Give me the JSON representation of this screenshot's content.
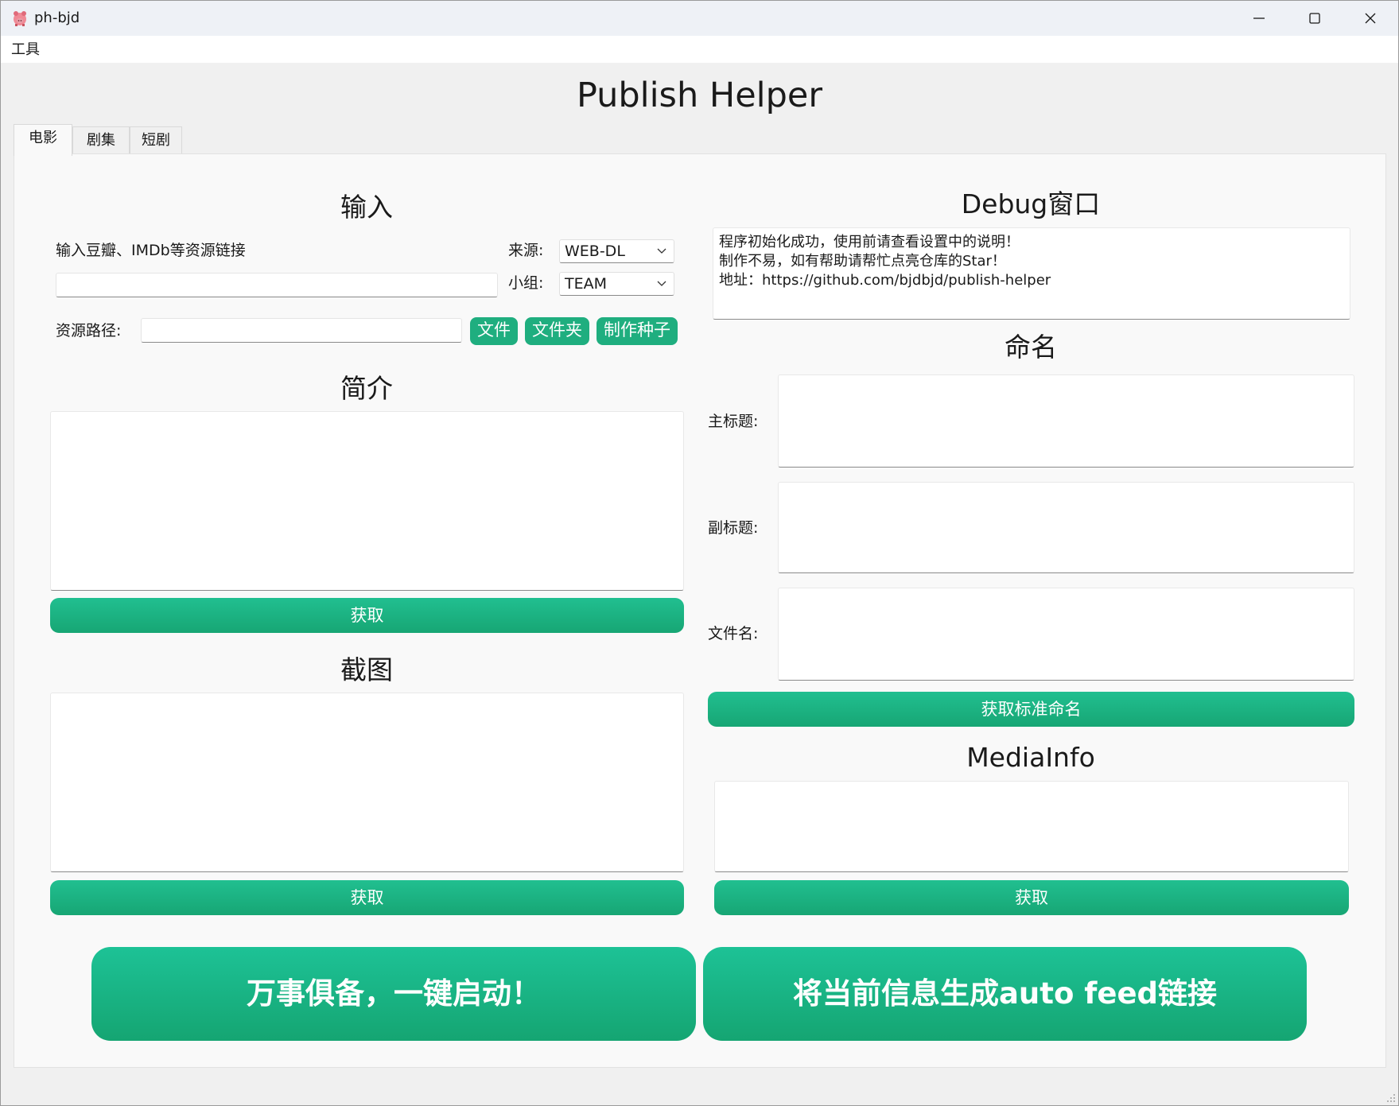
{
  "window": {
    "title": "ph-bjd",
    "icon": "pig-icon",
    "controls": [
      "minimize-icon",
      "maximize-icon",
      "close-icon"
    ]
  },
  "menu": {
    "tools": "工具"
  },
  "app": {
    "heading": "Publish Helper"
  },
  "tabs": [
    {
      "label": "电影",
      "active": true
    },
    {
      "label": "剧集",
      "active": false
    },
    {
      "label": "短剧",
      "active": false
    }
  ],
  "input_section": {
    "title": "输入",
    "link_label": "输入豆瓣、IMDb等资源链接",
    "link_value": "",
    "source_label": "来源:",
    "source_value": "WEB-DL",
    "team_label": "小组:",
    "team_value": "TEAM",
    "path_label": "资源路径:",
    "path_value": "",
    "file_button": "文件",
    "folder_button": "文件夹",
    "torrent_button": "制作种子"
  },
  "intro_section": {
    "title": "简介",
    "content": "",
    "fetch_button": "获取"
  },
  "screenshot_section": {
    "title": "截图",
    "content": "",
    "fetch_button": "获取"
  },
  "debug_section": {
    "title": "Debug窗口",
    "lines": "程序初始化成功，使用前请查看设置中的说明！\n制作不易，如有帮助请帮忙点亮仓库的Star！\n地址：https://github.com/bjdbjd/publish-helper"
  },
  "naming_section": {
    "title": "命名",
    "main_title_label": "主标题:",
    "main_title_value": "",
    "subtitle_label": "副标题:",
    "subtitle_value": "",
    "filename_label": "文件名:",
    "filename_value": "",
    "fetch_button": "获取标准命名"
  },
  "mediainfo_section": {
    "title": "MediaInfo",
    "content": "",
    "fetch_button": "获取"
  },
  "actions": {
    "start_button": "万事俱备，一键启动！",
    "autofeed_button": "将当前信息生成auto feed链接"
  },
  "colors": {
    "accent": "#1fae7f",
    "accent_light": "#21bf90",
    "window_bg": "#f0f0f0",
    "panel_bg": "#f9f9f9"
  }
}
